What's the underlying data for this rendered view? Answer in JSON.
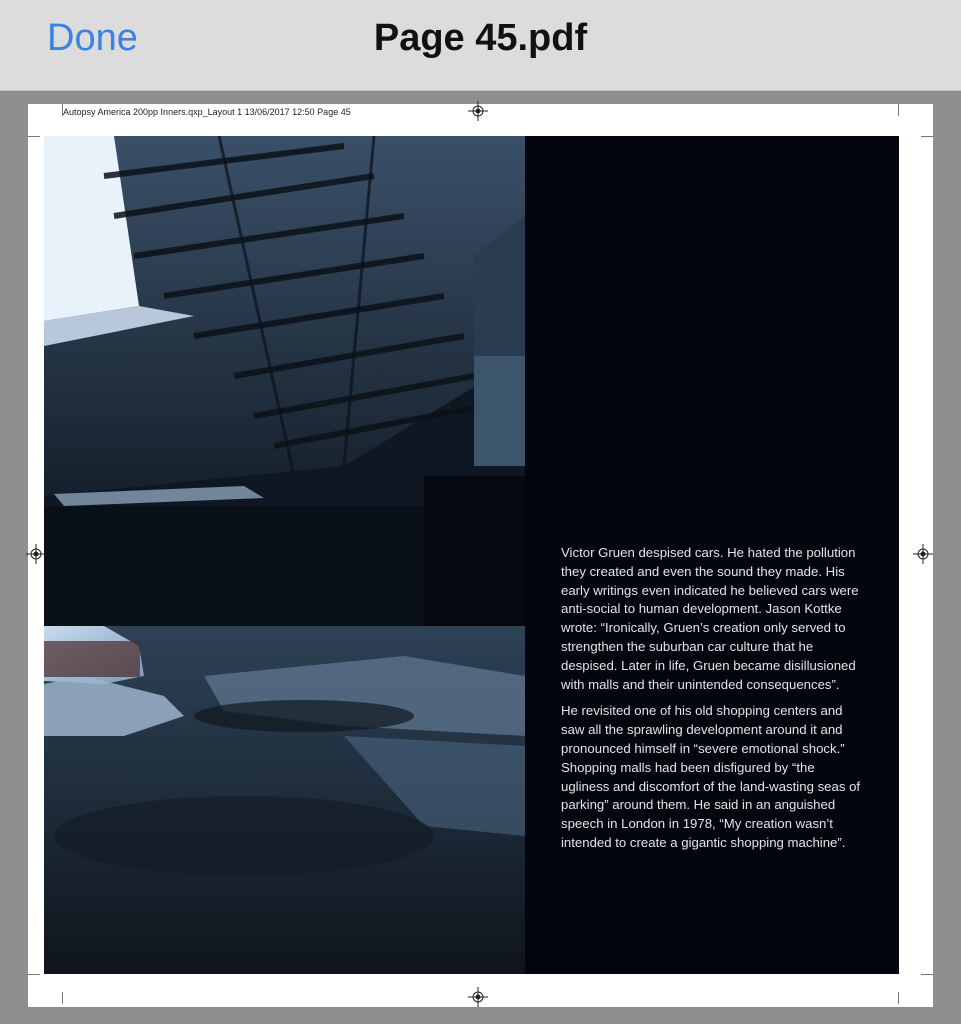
{
  "nav": {
    "done_label": "Done",
    "title": "Page 45.pdf"
  },
  "page": {
    "slug_line": "Autopsy America 200pp Inners.qxp_Layout 1  13/06/2017  12:50  Page 45",
    "paragraphs": [
      "Victor Gruen despised cars. He hated the pollution they created and even the sound they made. His early writings even indicated he believed cars were anti-social to human development. Jason Kottke wrote: “Ironically, Gruen’s creation only served to strengthen the suburban car culture that he despised. Later in life, Gruen became disillusioned with malls and their unintended consequences”.",
      "He revisited one of his old shopping centers and saw all the sprawling development around it and pronounced himself in “severe emotional shock.” Shopping malls had been disfigured by “the ugliness and discomfort of the land-wasting seas of parking” around them. He said in an anguished speech in London in 1978, “My creation wasn’t intended to create a gigantic shopping machine”."
    ]
  },
  "colors": {
    "accent": "#3b82e6",
    "navbar_bg": "#dcdcdc",
    "viewer_bg": "#8e8e8e",
    "text_panel_bg": "#03050e"
  }
}
